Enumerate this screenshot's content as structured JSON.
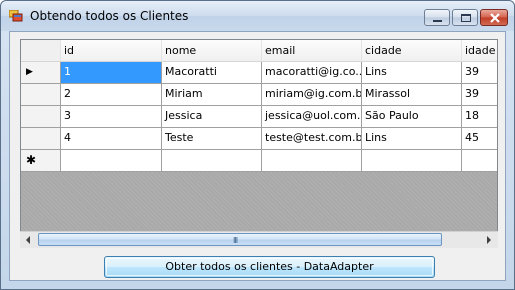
{
  "window": {
    "title": "Obtendo todos os Clientes",
    "icon": "windows-form-icon",
    "controls": [
      "minimize-icon",
      "maximize-icon",
      "close-icon"
    ]
  },
  "grid": {
    "columns": [
      "id",
      "nome",
      "email",
      "cidade",
      "idade"
    ],
    "rows": [
      {
        "id": "1",
        "nome": "Macoratti",
        "email": "macoratti@ig.co...",
        "cidade": "Lins",
        "idade": "39"
      },
      {
        "id": "2",
        "nome": "Miriam",
        "email": "miriam@ig.com.br",
        "cidade": "Mirassol",
        "idade": "39"
      },
      {
        "id": "3",
        "nome": "Jessica",
        "email": "jessica@uol.com.br",
        "cidade": "São Paulo",
        "idade": "18"
      },
      {
        "id": "4",
        "nome": "Teste",
        "email": "teste@test.com.br",
        "cidade": "Lins",
        "idade": "45"
      }
    ],
    "current_row_glyph": "▶",
    "new_row_glyph": "✱",
    "selected_cell": "row1-id"
  },
  "scrollbar": {
    "grip": "III"
  },
  "button": {
    "label": "Obter todos os clientes - DataAdapter"
  },
  "colors": {
    "selection": "#3399ff",
    "grid_background": "#a9a9a9"
  }
}
